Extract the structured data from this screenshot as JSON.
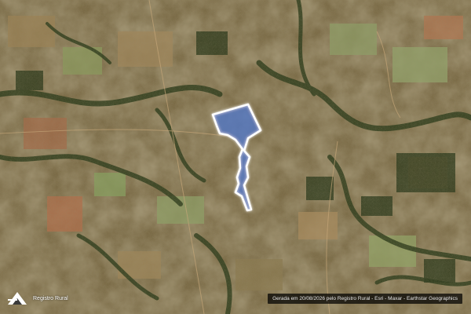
{
  "map": {
    "basemap": "satellite imagery",
    "boundary_color": "#ffffff",
    "boundary_glow": "#3f7bff",
    "fill_color": "#4a78d6"
  },
  "branding": {
    "name": "Registro Rural",
    "logo_icon": "registro-rural-logo-icon"
  },
  "attribution": {
    "text": "Gerada em 20/08/2026 pelo Registro Rural - Esri - Maxar - Earthstar Geographics"
  }
}
